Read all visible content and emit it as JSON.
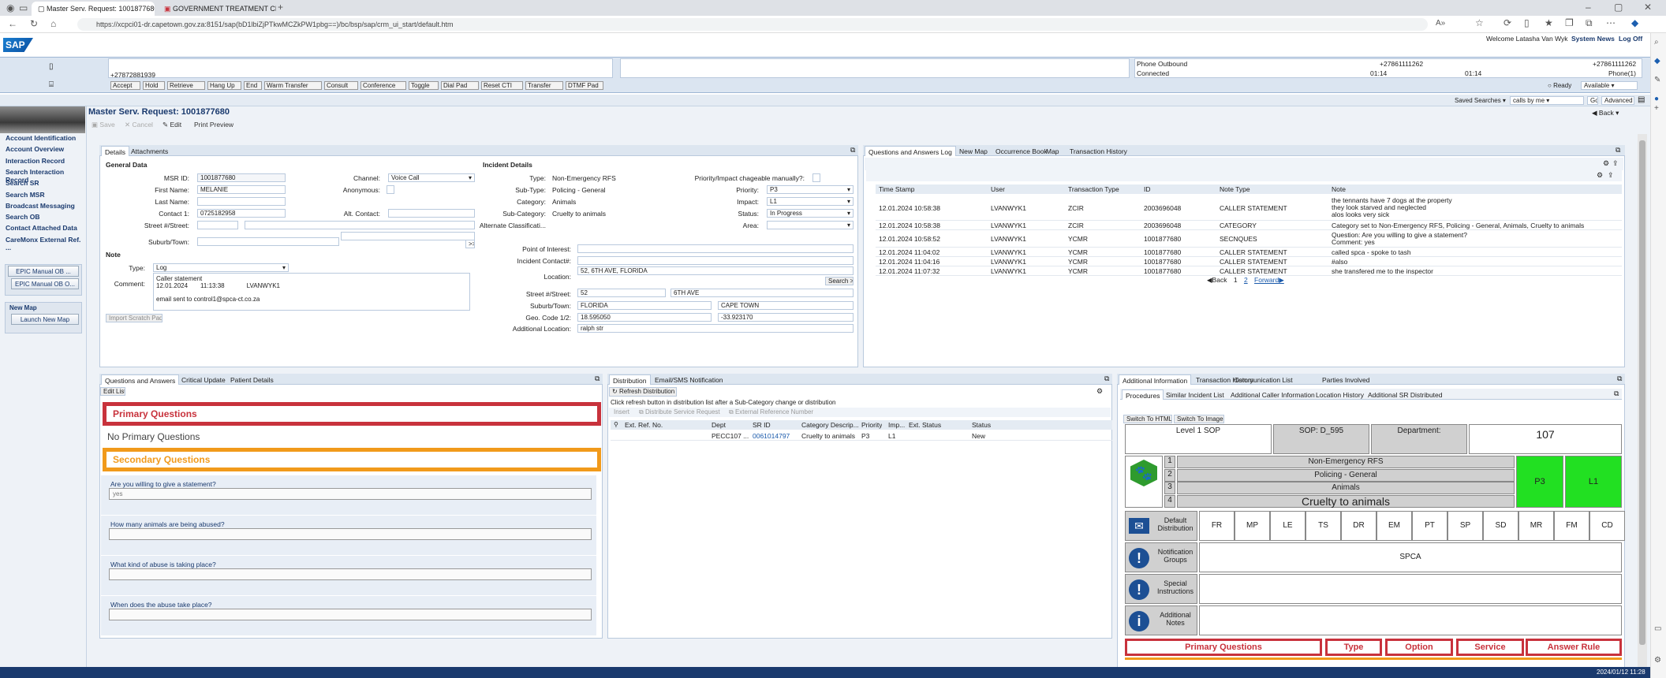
{
  "browser": {
    "tabs": [
      {
        "label": "Master Serv. Request: 1001877680"
      },
      {
        "label": "GOVERNMENT TREATMENT CE..."
      }
    ],
    "url": "https://xcpci01-dr.capetown.gov.za:8151/sap(bD1lbiZjPTkwMCZkPW1pbg==)/bc/bsp/sap/crm_ui_start/default.htm"
  },
  "sap": {
    "logo": "SAP",
    "welcome": "Welcome Latasha Van Wyk",
    "system_news": "System News",
    "log_off": "Log Off"
  },
  "cti": {
    "caller_number": "+27872881939",
    "phone_outbound_label": "Phone Outbound",
    "phone_outbound_number": "+27861111262",
    "phone_outbound_number2": "+27861111262",
    "connected_label": "Connected",
    "time1": "01:14",
    "time2": "01:14",
    "phone_count": "Phone(1)",
    "ready_label": "Ready",
    "status_value": "Available",
    "buttons": [
      "Accept",
      "Hold",
      "Retrieve",
      "Hang Up",
      "End",
      "Warm Transfer",
      "Consult",
      "Conference",
      "Toggle",
      "Dial Pad",
      "Reset CTI",
      "Transfer",
      "DTMF Pad"
    ]
  },
  "saved_searches": {
    "label": "Saved Searches",
    "value": "calls by me",
    "go": "Go",
    "advanced": "Advanced"
  },
  "nav": {
    "items": [
      "Account Identification",
      "Account Overview",
      "Interaction Record",
      "Search Interaction Record",
      "Search SR",
      "Search MSR",
      "Broadcast Messaging",
      "Search OB",
      "Contact Attached Data",
      "CareMonx External Ref. ..."
    ],
    "group1": [
      "EPIC Manual OB ...",
      "EPIC Manual OB O..."
    ],
    "group2": [
      "New Map",
      "Launch New Map"
    ]
  },
  "page": {
    "title": "Master Serv. Request: 1001877680",
    "back": "Back",
    "toolbar": {
      "save": "Save",
      "cancel": "Cancel",
      "edit": "Edit",
      "print": "Print Preview"
    }
  },
  "details": {
    "tabs": [
      "Details",
      "Attachments"
    ],
    "general_title": "General Data",
    "incident_title": "Incident Details",
    "labels": {
      "msr_id": "MSR ID:",
      "first_name": "First Name:",
      "last_name": "Last Name:",
      "contact1": "Contact 1:",
      "street": "Street #/Street:",
      "suburb": "Suburb/Town:",
      "channel": "Channel:",
      "anonymous": "Anonymous:",
      "alt_contact": "Alt. Contact:",
      "type": "Type:",
      "subtype": "Sub-Type:",
      "category": "Category:",
      "subcategory": "Sub-Category:",
      "alt_class": "Alternate Classificati...",
      "priority_impact": "Priority/Impact chageable manually?:",
      "priority": "Priority:",
      "impact": "Impact:",
      "status": "Status:",
      "area": "Area:",
      "poi": "Point of Interest:",
      "incident_contact": "Incident Contact#:",
      "location": "Location:",
      "inc_street": "Street #/Street:",
      "inc_suburb": "Suburb/Town:",
      "geo": "Geo. Code 1/2:",
      "add_loc": "Additional Location:"
    },
    "values": {
      "msr_id": "1001877680",
      "first_name": "MELANIE",
      "last_name": "",
      "contact1": "0725182958",
      "channel": "Voice Call",
      "type": "Non-Emergency RFS",
      "subtype": "Policing - General",
      "category": "Animals",
      "subcategory": "Cruelty to animals",
      "priority": "P3",
      "impact": "L1",
      "status": "In Progress",
      "location": "52, 6TH AVE, FLORIDA",
      "street_no": "52",
      "street_name": "6TH AVE",
      "suburb": "FLORIDA",
      "city": "CAPE TOWN",
      "geo1": "18.595050",
      "geo2": "-33.923170",
      "add_loc": "ralph str"
    },
    "search_btn": "Search >",
    "more_btn": ">>",
    "note": {
      "title": "Note",
      "type_label": "Type:",
      "type_value": "Log",
      "comment_label": "Comment:",
      "lines": [
        "Caller statement",
        "12.01.2024",
        "11:13:38",
        "LVANWYK1",
        "email sent to control1@spca-ct.co.za"
      ]
    },
    "import_btn": "Import Scratch Pad"
  },
  "qa_log": {
    "tabs": [
      "Questions and Answers Log",
      "New Map",
      "Occurrence Book",
      "Map",
      "Transaction History"
    ],
    "headers": [
      "Time Stamp",
      "User",
      "Transaction Type",
      "ID",
      "Note Type",
      "Note"
    ],
    "rows": [
      {
        "ts": "12.01.2024 10:58:38",
        "user": "LVANWYK1",
        "tt": "ZCIR",
        "id": "2003696048",
        "nt": "CALLER STATEMENT",
        "note": [
          "the tennants have 7 dogs at the property",
          "they look starved and neglected",
          "alos looks very sick"
        ]
      },
      {
        "ts": "12.01.2024 10:58:38",
        "user": "LVANWYK1",
        "tt": "ZCIR",
        "id": "2003696048",
        "nt": "CATEGORY",
        "note": [
          "Category set to Non-Emergency RFS, Policing - General, Animals, Cruelty to animals"
        ]
      },
      {
        "ts": "12.01.2024 10:58:52",
        "user": "LVANWYK1",
        "tt": "YCMR",
        "id": "1001877680",
        "nt": "SECNQUES",
        "note": [
          "Question: Are you willing to give a statement?",
          "Comment:  yes"
        ]
      },
      {
        "ts": "12.01.2024 11:04:02",
        "user": "LVANWYK1",
        "tt": "YCMR",
        "id": "1001877680",
        "nt": "CALLER STATEMENT",
        "note": [
          "called spca - spoke to tash"
        ]
      },
      {
        "ts": "12.01.2024 11:04:16",
        "user": "LVANWYK1",
        "tt": "YCMR",
        "id": "1001877680",
        "nt": "CALLER STATEMENT",
        "note": [
          "#also"
        ]
      },
      {
        "ts": "12.01.2024 11:07:32",
        "user": "LVANWYK1",
        "tt": "YCMR",
        "id": "1001877680",
        "nt": "CALLER STATEMENT",
        "note": [
          "she transfered me to the inspector"
        ]
      }
    ],
    "pager": {
      "back": "Back",
      "p1": "1",
      "p2": "2",
      "fwd": "Forward"
    }
  },
  "qa_panel": {
    "tabs": [
      "Questions and Answers",
      "Critical Update",
      "Patient Details"
    ],
    "edit_list": "Edit List",
    "primary": "Primary Questions",
    "no_primary": "No Primary Questions",
    "secondary": "Secondary Questions",
    "questions": [
      {
        "q": "Are you willing to give a statement?",
        "a": "yes"
      },
      {
        "q": "How many animals are being abused?",
        "a": ""
      },
      {
        "q": "What kind of abuse is taking place?",
        "a": ""
      },
      {
        "q": "When does the abuse take place?",
        "a": ""
      }
    ]
  },
  "distribution": {
    "tabs": [
      "Distribution",
      "Email/SMS Notification"
    ],
    "refresh": "Refresh Distribution",
    "hint": "Click refresh button in distribution list after a Sub-Category change or distribution",
    "actions": [
      "Insert",
      "Distribute Service Request",
      "External Reference Number"
    ],
    "headers": [
      "Ext. Ref. No.",
      "Dept",
      "SR ID",
      "Category Descrip...",
      "Priority",
      "Imp...",
      "Ext. Status",
      "Status"
    ],
    "row": {
      "ext": "",
      "dept": "PECC107 ...",
      "sr": "0061014797",
      "cat": "Cruelty to animals",
      "prio": "P3",
      "imp": "L1",
      "ext_status": "",
      "status": "New"
    }
  },
  "additional": {
    "tabs": [
      "Additional Information",
      "Transaction History",
      "Communication List",
      "Parties Involved"
    ],
    "subtabs": [
      "Procedures",
      "Similar Incident List",
      "Additional Caller Information",
      "Location History",
      "Additional SR Distributed"
    ],
    "switch_html": "Switch To HTML",
    "switch_image": "Switch To Image",
    "sop_level": "Level 1 SOP",
    "sop_id": "SOP: D_595",
    "department_label": "Department:",
    "department_value": "107",
    "levels": [
      {
        "n": "1",
        "v": "Non-Emergency RFS"
      },
      {
        "n": "2",
        "v": "Policing - General"
      },
      {
        "n": "3",
        "v": "Animals"
      },
      {
        "n": "4",
        "v": "Cruelty to animals"
      }
    ],
    "priority": "P3",
    "impact": "L1",
    "default_distribution": "Default Distribution",
    "dist_codes": [
      "FR",
      "MP",
      "LE",
      "TS",
      "DR",
      "EM",
      "PT",
      "SP",
      "SD",
      "MR",
      "FM",
      "CD"
    ],
    "notification_groups": "Notification Groups",
    "notification_value": "SPCA",
    "special_instructions": "Special Instructions",
    "additional_notes": "Additional Notes",
    "table_headers": [
      "Primary Questions",
      "Type",
      "Option",
      "Service",
      "Answer Rule"
    ]
  },
  "footer": {
    "timestamp": "2024/01/12 11:28"
  },
  "colors": {
    "primary_red": "#c8323c",
    "secondary_orange": "#f19a1b",
    "green": "#22e022",
    "sap_blue": "#1a3a6e"
  }
}
